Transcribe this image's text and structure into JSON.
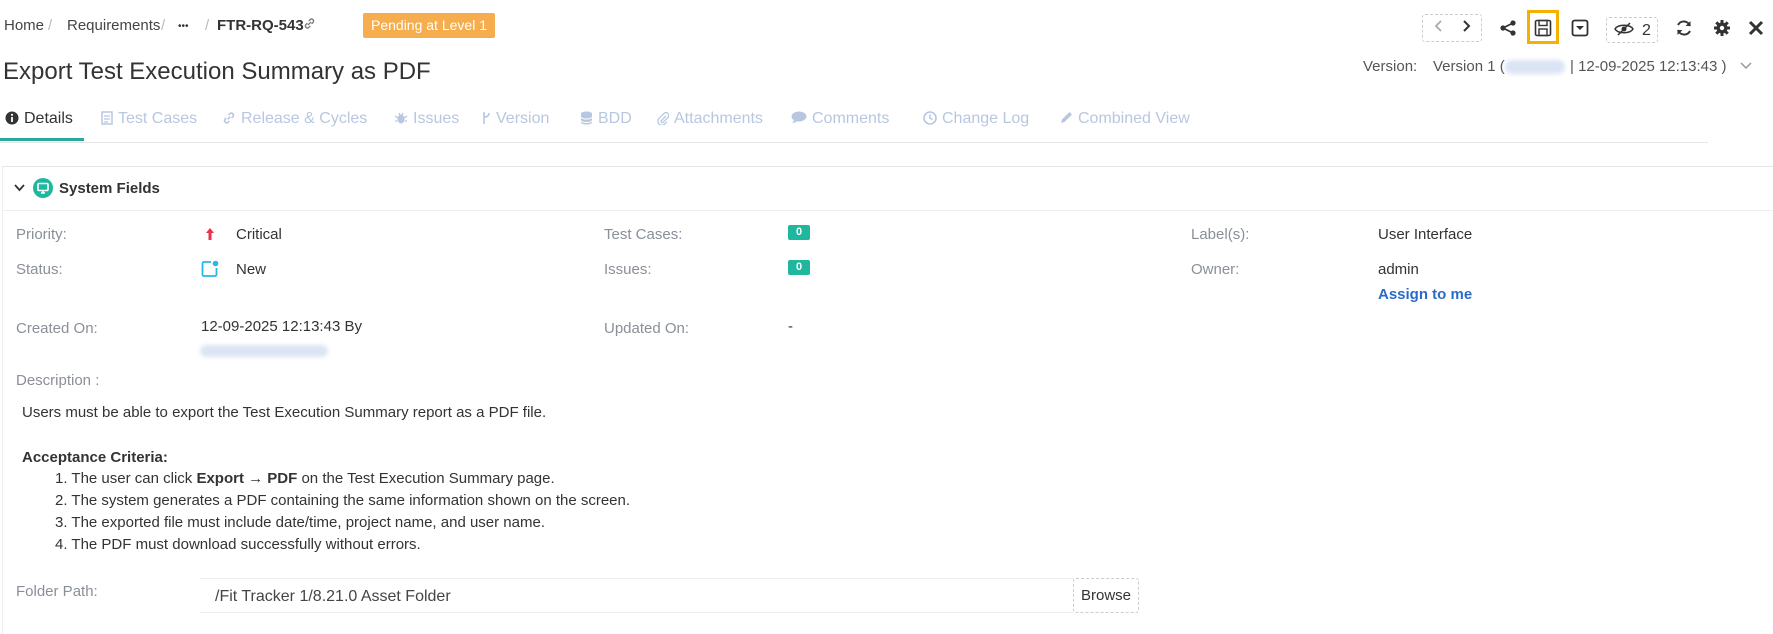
{
  "breadcrumb": {
    "home": "Home",
    "requirements": "Requirements",
    "more": "•••",
    "current_id": "FTR-RQ-543"
  },
  "status_badge": "Pending at Level 1",
  "watchers_count": "2",
  "page_title": "Export Test Execution Summary as PDF",
  "version": {
    "label": "Version:",
    "value_prefix": "Version 1 (",
    "value_suffix": "| 12-09-2025 12:13:43 )"
  },
  "tabs": [
    {
      "label": "Details",
      "icon": "info-icon"
    },
    {
      "label": "Test Cases",
      "icon": "document-icon"
    },
    {
      "label": "Release & Cycles",
      "icon": "link-icon"
    },
    {
      "label": "Issues",
      "icon": "bug-icon"
    },
    {
      "label": "Version",
      "icon": "branch-icon"
    },
    {
      "label": "BDD",
      "icon": "database-icon"
    },
    {
      "label": "Attachments",
      "icon": "paperclip-icon"
    },
    {
      "label": "Comments",
      "icon": "comment-icon"
    },
    {
      "label": "Change Log",
      "icon": "clock-icon"
    },
    {
      "label": "Combined View",
      "icon": "pencil-icon"
    }
  ],
  "system_fields": {
    "title": "System Fields",
    "priority_label": "Priority:",
    "priority_value": "Critical",
    "status_label": "Status:",
    "status_value": "New",
    "created_label": "Created On:",
    "created_value": "12-09-2025 12:13:43 By",
    "test_cases_label": "Test Cases:",
    "test_cases_count": "0",
    "issues_label": "Issues:",
    "issues_count": "0",
    "updated_label": "Updated On:",
    "updated_value": "-",
    "labels_label": "Label(s):",
    "labels_value": "User Interface",
    "owner_label": "Owner:",
    "owner_value": "admin",
    "assign_link": "Assign to me"
  },
  "description": {
    "label": "Description :",
    "text": "Users must be able to export the Test Execution Summary report as a PDF file.",
    "acceptance_title": "Acceptance Criteria:",
    "criteria": [
      {
        "before": "1. The user can click ",
        "bold": "Export → PDF",
        "after": " on the Test Execution Summary page."
      },
      {
        "before": "2. The system generates a PDF containing the same information shown on the screen.",
        "bold": "",
        "after": ""
      },
      {
        "before": "3. The exported file must include date/time, project name, and user name.",
        "bold": "",
        "after": ""
      },
      {
        "before": "4. The PDF must download successfully without errors.",
        "bold": "",
        "after": ""
      }
    ]
  },
  "folder": {
    "label": "Folder Path:",
    "value": "/Fit Tracker 1/8.21.0 Asset Folder",
    "browse_label": "Browse"
  },
  "colors": {
    "accent": "#2aa89a",
    "badge": "#f6ad4d",
    "count_badge": "#1fb79e",
    "link": "#2a6bc9",
    "highlight": "#f5b000"
  }
}
